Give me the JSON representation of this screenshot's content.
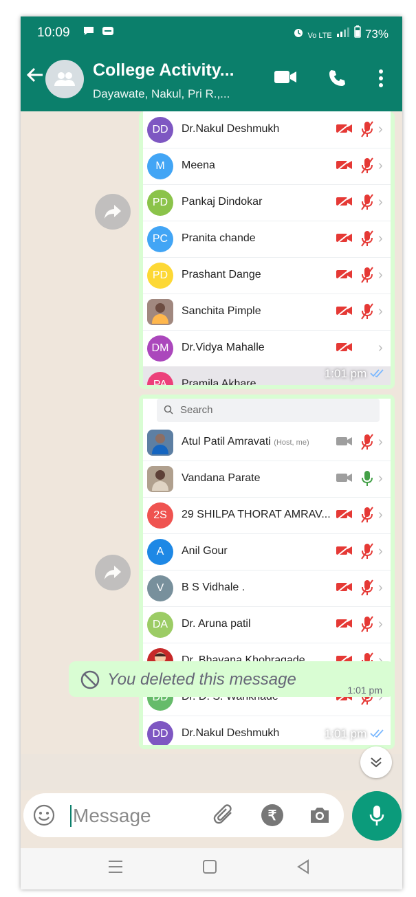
{
  "status_bar": {
    "time": "10:09",
    "battery": "73%"
  },
  "header": {
    "title": "College Activity...",
    "subtitle": "Dayawate, Nakul, Pri R.,..."
  },
  "bubble1": {
    "timestamp": "1:01 pm",
    "participants": [
      {
        "initials": "DD",
        "name": "Dr.Nakul Deshmukh",
        "color": "#7e57c2",
        "cam": "off",
        "mic": "off"
      },
      {
        "initials": "M",
        "name": "Meena",
        "color": "#42a5f5",
        "cam": "off",
        "mic": "off"
      },
      {
        "initials": "PD",
        "name": "Pankaj Dindokar",
        "color": "#8bc34a",
        "cam": "off",
        "mic": "off"
      },
      {
        "initials": "PC",
        "name": "Pranita chande",
        "color": "#42a5f5",
        "cam": "off",
        "mic": "off"
      },
      {
        "initials": "PD",
        "name": "Prashant Dange",
        "color": "#fdd835",
        "cam": "off",
        "mic": "off"
      },
      {
        "initials": "",
        "name": "Sanchita Pimple",
        "color": "#a1887f",
        "cam": "off",
        "mic": "off"
      },
      {
        "initials": "DM",
        "name": "Dr.Vidya Mahalle",
        "color": "#ab47bc",
        "cam": "off",
        "mic": "none"
      },
      {
        "initials": "PA",
        "name": "Pramila Akhare",
        "color": "#ec407a",
        "cam": "off",
        "mic": "off"
      }
    ]
  },
  "bubble2": {
    "search_placeholder": "Search",
    "timestamp": "1:01 pm",
    "participants": [
      {
        "initials": "",
        "name": "Atul Patil Amravati",
        "tag": "(Host, me)",
        "color": "#5d7fa3",
        "cam": "gray",
        "mic": "off"
      },
      {
        "initials": "",
        "name": "Vandana Parate",
        "color": "#b0a08e",
        "cam": "gray",
        "mic": "on"
      },
      {
        "initials": "2S",
        "name": "29 SHILPA THORAT AMRAV...",
        "color": "#ef5350",
        "cam": "off",
        "mic": "off"
      },
      {
        "initials": "A",
        "name": "Anil Gour",
        "color": "#1e88e5",
        "cam": "off",
        "mic": "off"
      },
      {
        "initials": "V",
        "name": "B S Vidhale .",
        "color": "#78909c",
        "cam": "off",
        "mic": "off"
      },
      {
        "initials": "DA",
        "name": "Dr. Aruna patil",
        "color": "#9ccc65",
        "cam": "off",
        "mic": "off"
      },
      {
        "initials": "",
        "name": "Dr. Bhavana Khobragade",
        "color": "#c62828",
        "cam": "off",
        "mic": "off"
      },
      {
        "initials": "DD",
        "name": "Dr. D. S. Wankhade",
        "color": "#66bb6a",
        "cam": "off",
        "mic": "off"
      },
      {
        "initials": "DD",
        "name": "Dr.Nakul Deshmukh",
        "color": "#7e57c2",
        "cam": "off",
        "mic": "off"
      }
    ]
  },
  "deleted": {
    "text": "You deleted this message",
    "timestamp": "1:01 pm"
  },
  "composer": {
    "placeholder": "Message"
  }
}
